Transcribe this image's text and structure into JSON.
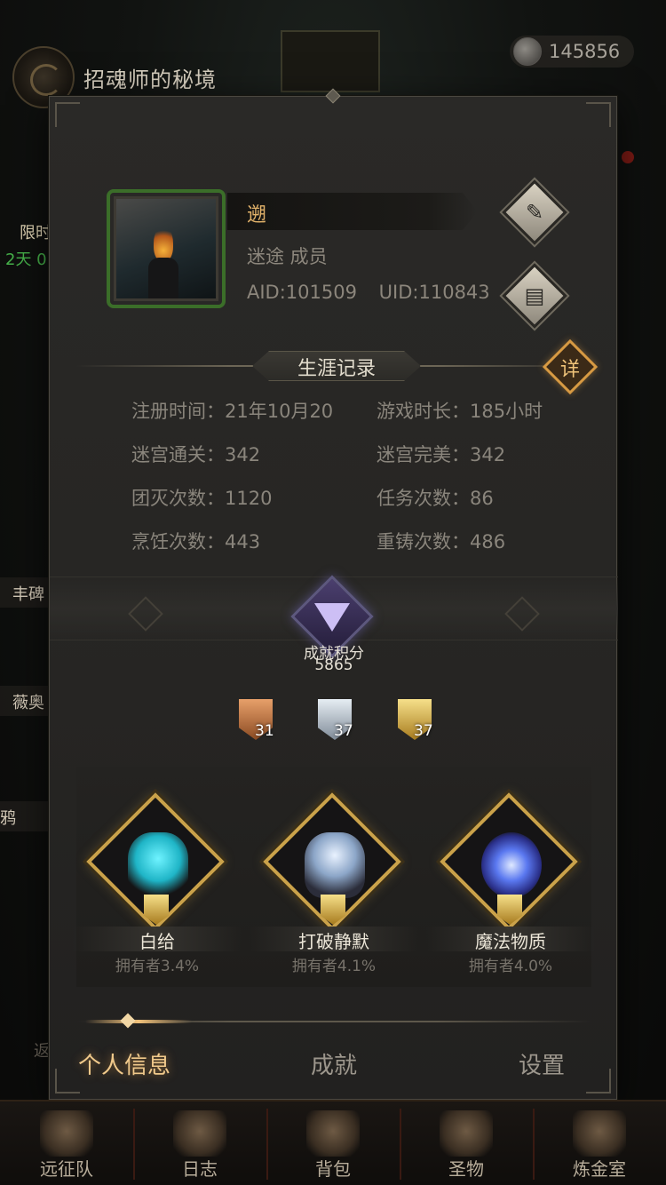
{
  "top": {
    "title": "招魂师的秘境",
    "currency_value": "145856",
    "currency_icon": "stone-coin-icon"
  },
  "side": {
    "limited_label": "限时",
    "limited_timer": "2天 0",
    "tag1": "丰碑",
    "tag2": "薇奥",
    "tag3": "鸦",
    "tag4": "返"
  },
  "profile": {
    "name": "遡",
    "guild": "迷途 成员",
    "aid": "AID:101509",
    "uid": "UID:110843",
    "edit_icon": "quill-icon",
    "copy_icon": "scroll-icon"
  },
  "career": {
    "title": "生涯记录",
    "detail_label": "详",
    "stats": [
      "注册时间：21年10月20",
      "游戏时长：185小时",
      "迷宫通关：342",
      "迷宫完美：342",
      "团灭次数：1120",
      "任务次数：86",
      "烹饪次数：443",
      "重铸次数：486"
    ]
  },
  "achievement": {
    "label": "成就积分",
    "score": "5865",
    "medals": [
      {
        "tier": "bronze",
        "count": "31"
      },
      {
        "tier": "silver",
        "count": "37"
      },
      {
        "tier": "gold",
        "count": "37"
      }
    ],
    "showcase": [
      {
        "name": "白给",
        "owner": "拥有者3.4%"
      },
      {
        "name": "打破静默",
        "owner": "拥有者4.1%"
      },
      {
        "name": "魔法物质",
        "owner": "拥有者4.0%"
      }
    ]
  },
  "tabs": [
    "个人信息",
    "成就",
    "设置"
  ],
  "nav": [
    "远征队",
    "日志",
    "背包",
    "圣物",
    "炼金室"
  ],
  "colors": {
    "accent_gold": "#f0c98b",
    "name_orange": "#e2b26a",
    "timer_green": "#46b24a"
  }
}
